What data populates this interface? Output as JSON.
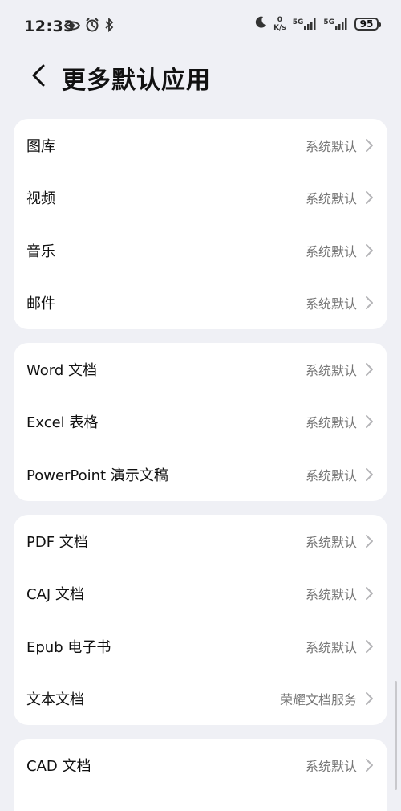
{
  "status_bar": {
    "time": "12:33",
    "net_speed_top": "0",
    "net_speed_unit": "K/s",
    "signal1_label": "5G",
    "signal2_label": "5G",
    "battery": "95"
  },
  "header": {
    "title": "更多默认应用"
  },
  "groups": [
    {
      "items": [
        {
          "label": "图库",
          "value": "系统默认"
        },
        {
          "label": "视频",
          "value": "系统默认"
        },
        {
          "label": "音乐",
          "value": "系统默认"
        },
        {
          "label": "邮件",
          "value": "系统默认"
        }
      ]
    },
    {
      "items": [
        {
          "label": "Word 文档",
          "value": "系统默认"
        },
        {
          "label": "Excel 表格",
          "value": "系统默认"
        },
        {
          "label": "PowerPoint 演示文稿",
          "value": "系统默认"
        }
      ]
    },
    {
      "items": [
        {
          "label": "PDF 文档",
          "value": "系统默认"
        },
        {
          "label": "CAJ 文档",
          "value": "系统默认"
        },
        {
          "label": "Epub 电子书",
          "value": "系统默认"
        },
        {
          "label": "文本文档",
          "value": "荣耀文档服务"
        }
      ]
    },
    {
      "items": [
        {
          "label": "CAD 文档",
          "value": "系统默认"
        }
      ]
    }
  ]
}
